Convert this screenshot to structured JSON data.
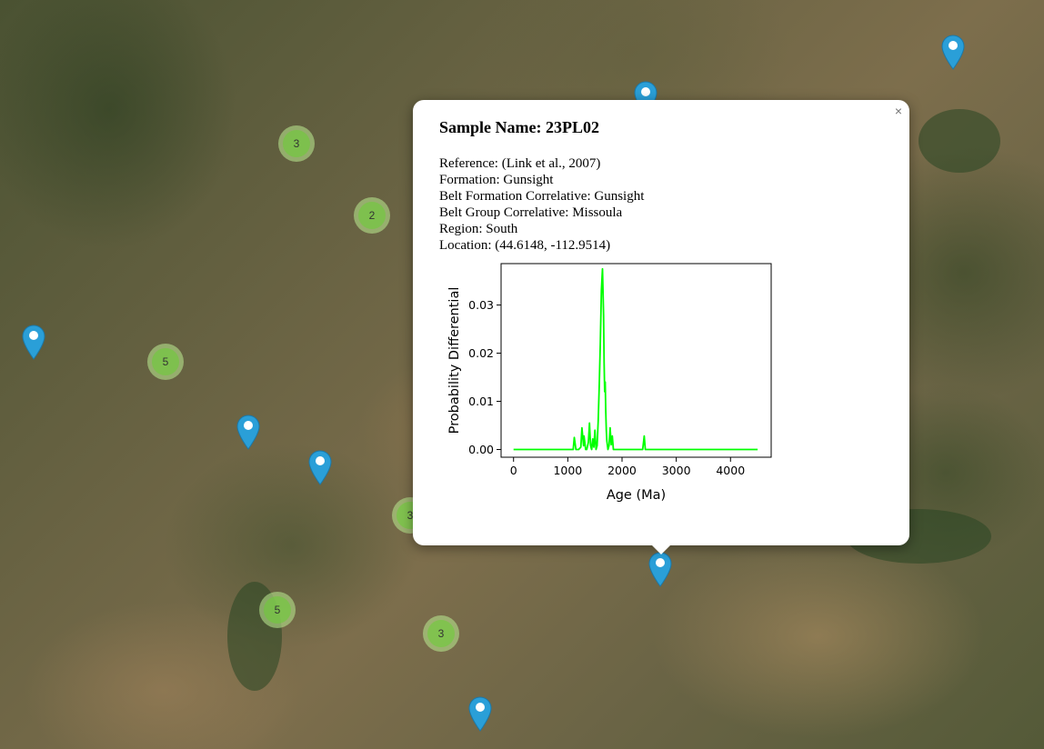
{
  "popup": {
    "close_label": "×",
    "title": "Sample Name: 23PL02",
    "lines": {
      "reference": "Reference: (Link et al., 2007)",
      "formation": "Formation: Gunsight",
      "belt_formation": "Belt Formation Correlative: Gunsight",
      "belt_group": "Belt Group Correlative: Missoula",
      "region": "Region: South",
      "location": "Location: (44.6148, -112.9514)"
    }
  },
  "clusters": [
    {
      "count": "3"
    },
    {
      "count": "2"
    },
    {
      "count": "5"
    },
    {
      "count": "3"
    },
    {
      "count": "5"
    },
    {
      "count": "3"
    }
  ],
  "colors": {
    "cluster_outer": "#b5e28c",
    "cluster_inner": "#6ecc39",
    "marker": "#2a9fd8",
    "line": "#00ff00"
  },
  "chart_data": {
    "type": "line",
    "xlabel": "Age (Ma)",
    "ylabel": "Probability Differential",
    "xlim": [
      -230,
      4750
    ],
    "ylim": [
      -0.0016,
      0.0386
    ],
    "x_ticks": [
      0,
      1000,
      2000,
      3000,
      4000
    ],
    "y_ticks": [
      0.0,
      0.01,
      0.02,
      0.03
    ],
    "x_tick_labels": [
      "0",
      "1000",
      "2000",
      "3000",
      "4000"
    ],
    "y_tick_labels": [
      "0.00",
      "0.01",
      "0.02",
      "0.03"
    ],
    "series": [
      {
        "color": "#00ff00",
        "x": [
          0,
          1050,
          1100,
          1120,
          1150,
          1200,
          1240,
          1260,
          1290,
          1300,
          1330,
          1350,
          1380,
          1400,
          1420,
          1440,
          1460,
          1480,
          1500,
          1520,
          1540,
          1560,
          1580,
          1600,
          1620,
          1640,
          1660,
          1670,
          1680,
          1690,
          1700,
          1710,
          1720,
          1740,
          1760,
          1780,
          1800,
          1820,
          1840,
          1860,
          1880,
          1900,
          1920,
          1950,
          2000,
          2300,
          2380,
          2410,
          2430,
          2460,
          2500,
          4500
        ],
        "y": [
          0.0,
          0.0,
          0.0,
          0.0025,
          0.0,
          0.0,
          0.0005,
          0.0045,
          0.0008,
          0.0028,
          0.0,
          0.0,
          0.0015,
          0.0055,
          0.0008,
          0.0,
          0.0022,
          0.0005,
          0.004,
          0.0,
          0.0008,
          0.006,
          0.013,
          0.022,
          0.033,
          0.0375,
          0.028,
          0.018,
          0.012,
          0.014,
          0.008,
          0.004,
          0.0018,
          0.0,
          0.0008,
          0.0045,
          0.001,
          0.0028,
          0.0,
          0.0,
          0.0,
          0.0,
          0.0,
          0.0,
          0.0,
          0.0,
          0.0,
          0.0028,
          0.0,
          0.0,
          0.0,
          0.0
        ]
      }
    ]
  }
}
